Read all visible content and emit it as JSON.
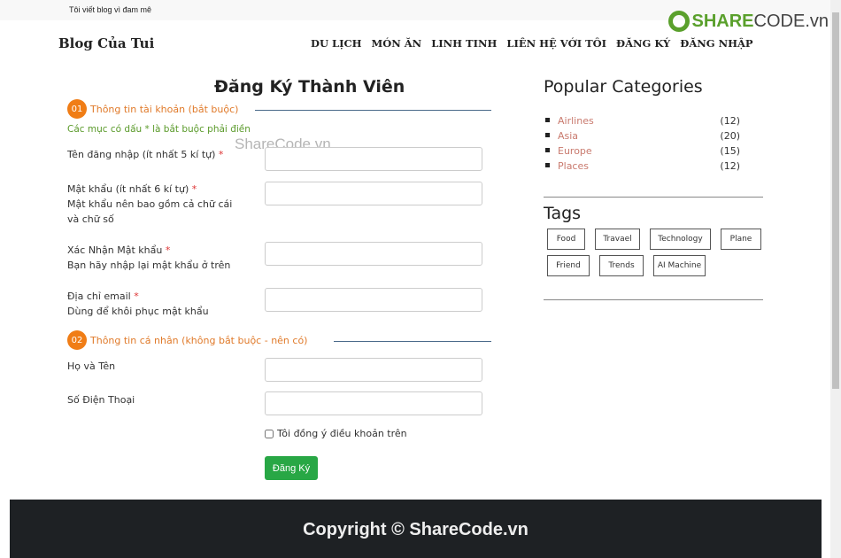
{
  "topbar": {
    "tagline": "Tôi viết blog vì đam mê"
  },
  "watermark_logo": "SHARECODE.vn",
  "nav": {
    "brand": "Blog Của Tui",
    "items": [
      "DU LỊCH",
      "MÓN ĂN",
      "LINH TINH",
      "LIÊN HỆ VỚI TÔI",
      "ĐĂNG KÝ",
      "ĐĂNG NHẬP"
    ]
  },
  "form": {
    "title": "Đăng Ký Thành Viên",
    "section1": {
      "num": "01",
      "label": "Thông tin tài khoản (bắt buộc)"
    },
    "note": "Các mục có dấu * là bắt buộc phải điền",
    "watermark": "ShareCode.vn",
    "fields": [
      {
        "label": "Tên đăng nhập (ít nhất 5 kí tự)",
        "req": "*",
        "hint": ""
      },
      {
        "label": "Mật khẩu (ít nhất 6 kí tự)",
        "req": "*",
        "hint": "Mật khẩu nên bao gồm cả chữ cái và chữ số"
      },
      {
        "label": "Xác Nhận Mật khẩu",
        "req": "*",
        "hint": "Bạn hãy nhập lại mật khẩu ở trên"
      },
      {
        "label": "Địa chỉ email",
        "req": "*",
        "hint": "Dùng để khôi phục mật khẩu"
      }
    ],
    "section2": {
      "num": "02",
      "label": "Thông tin cá nhân (không bắt buộc - nên có)"
    },
    "fields2": [
      {
        "label": "Họ và Tên"
      },
      {
        "label": "Số Điện Thoại"
      }
    ],
    "agree": "Tôi đồng ý điều khoản trên",
    "submit": "Đăng Ký"
  },
  "sidebar": {
    "categories_title": "Popular Categories",
    "categories": [
      {
        "name": "Airlines",
        "count": "(12)"
      },
      {
        "name": "Asia",
        "count": "(20)"
      },
      {
        "name": "Europe",
        "count": "(15)"
      },
      {
        "name": "Places",
        "count": "(12)"
      }
    ],
    "tags_title": "Tags",
    "tags": [
      "Food",
      "Travael",
      "Technology",
      "Plane",
      "Friend",
      "Trends",
      "AI Machine"
    ]
  },
  "footer": {
    "copyright": "Copyright © ShareCode.vn"
  }
}
